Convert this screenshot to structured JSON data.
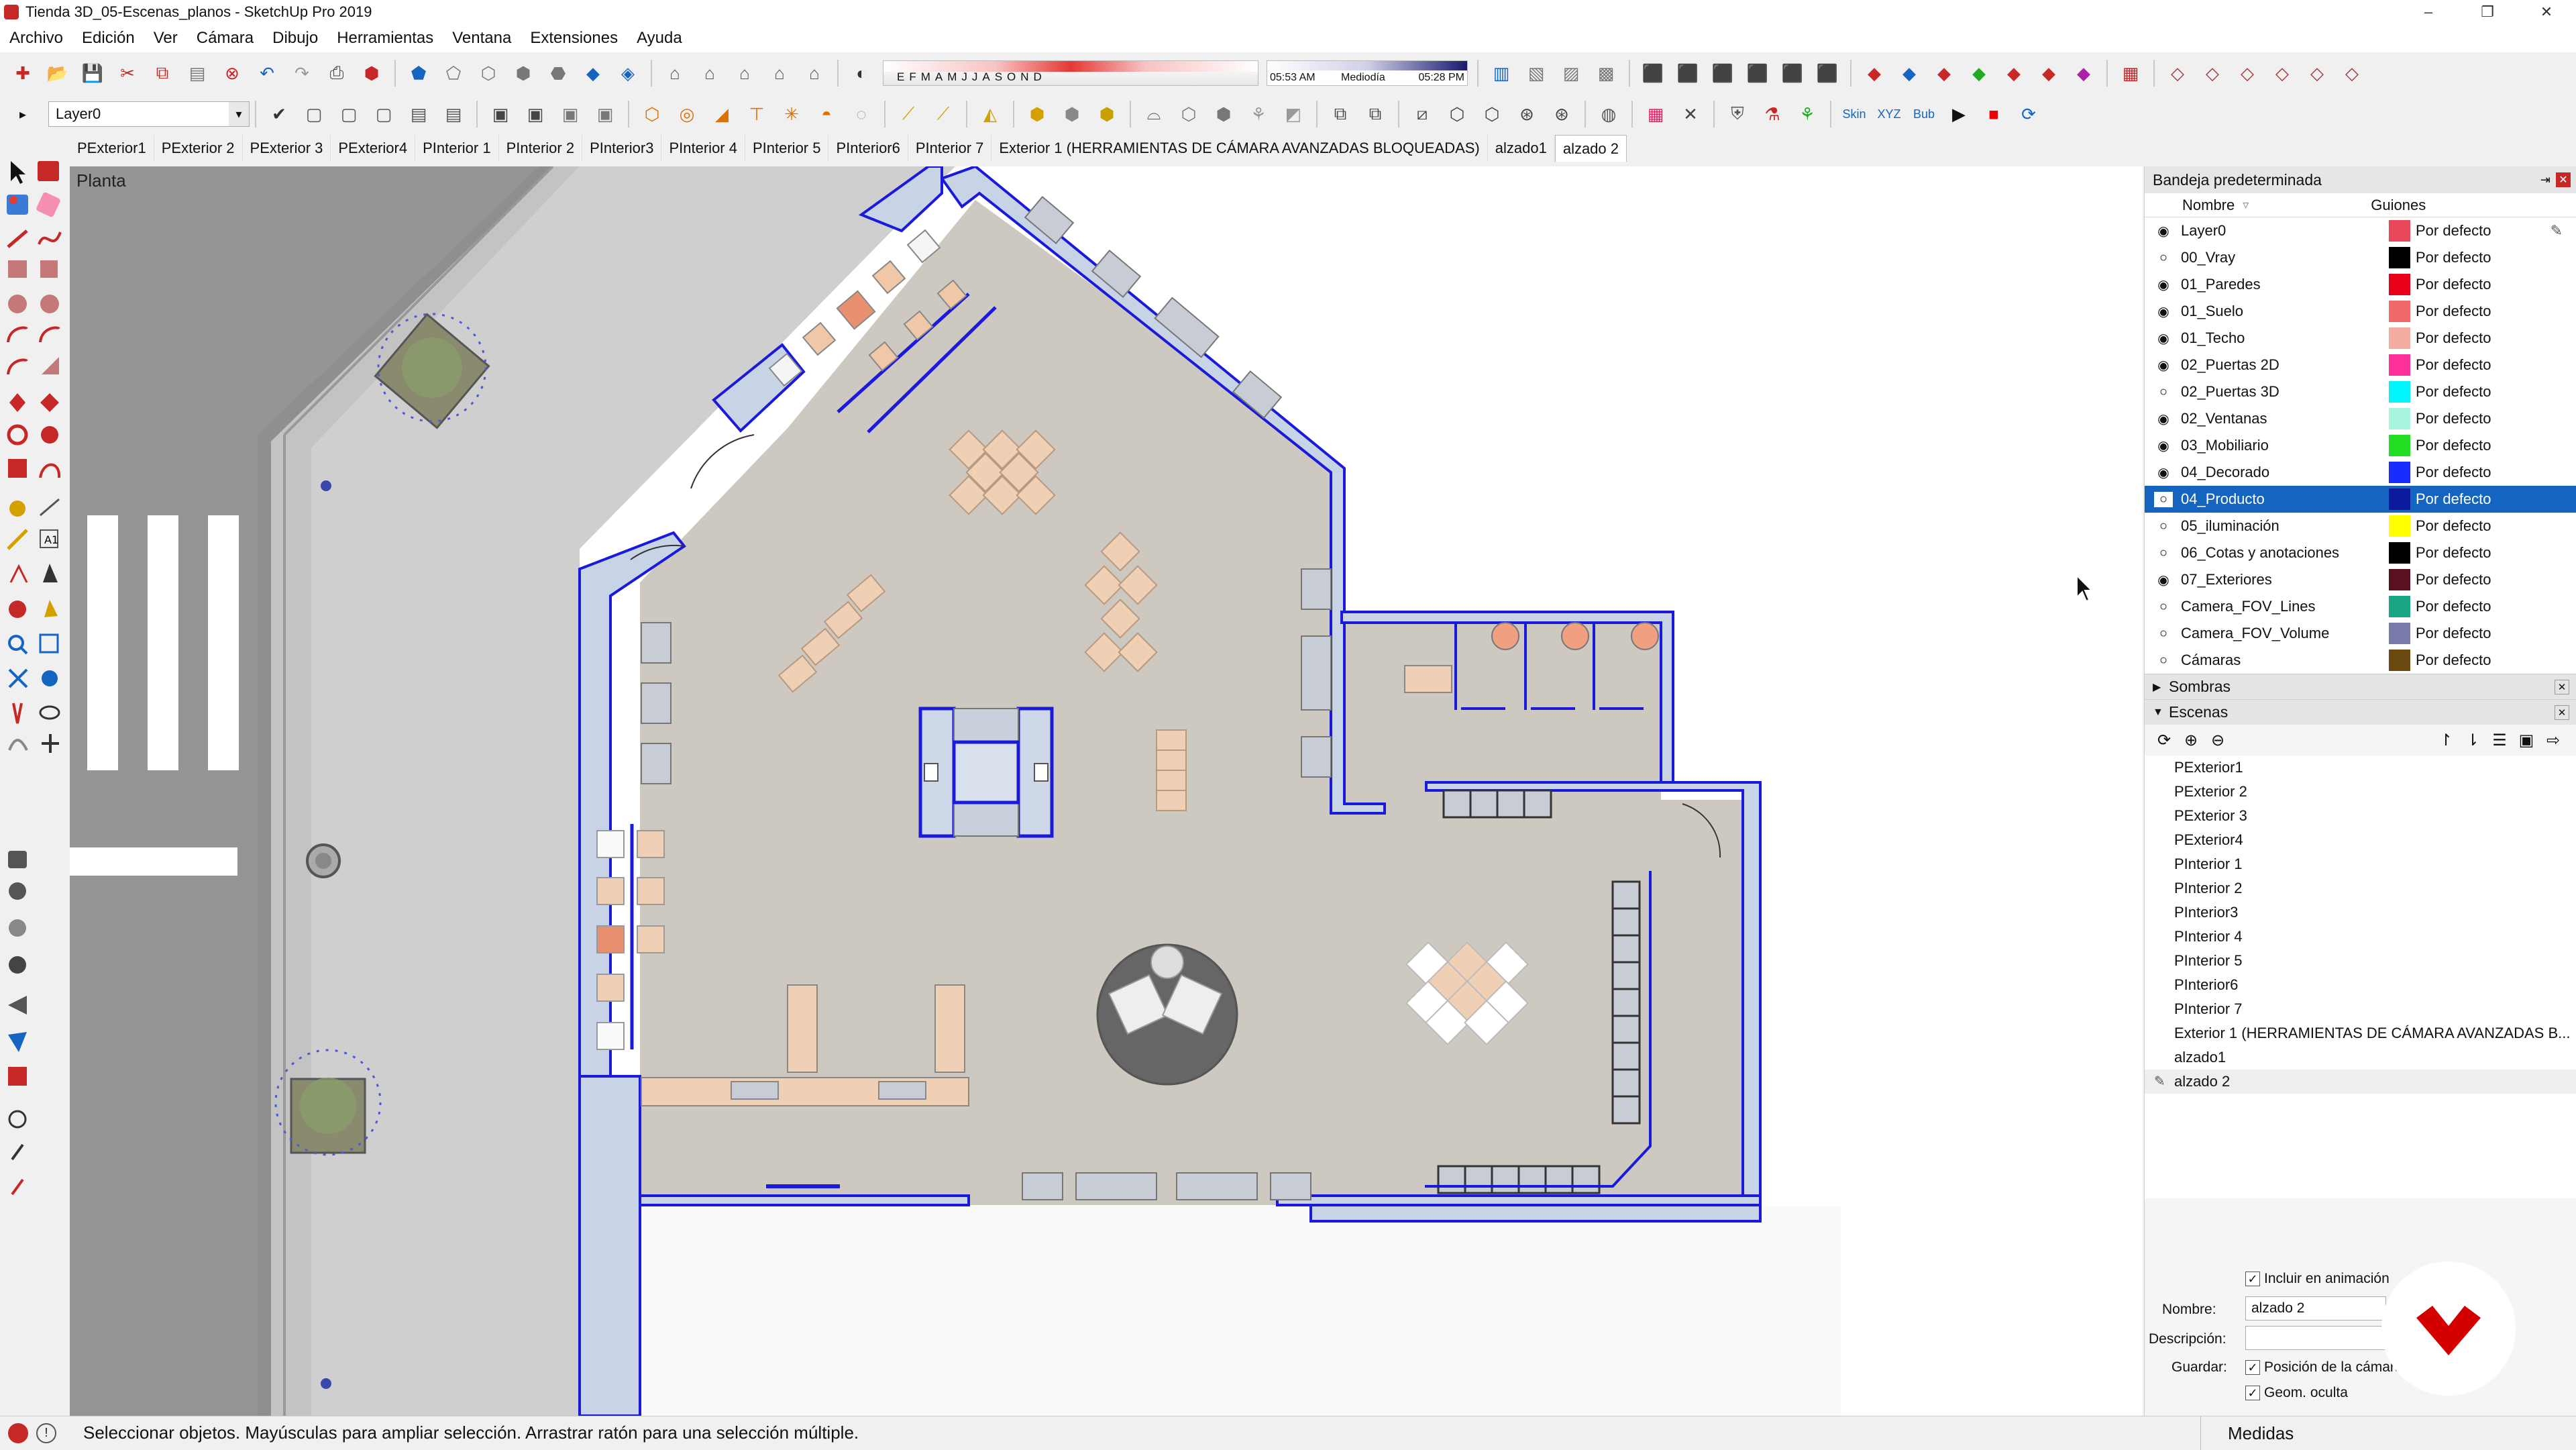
{
  "window": {
    "title": "Tienda 3D_05-Escenas_planos - SketchUp Pro 2019",
    "controls": [
      "–",
      "❐",
      "✕"
    ]
  },
  "menu": [
    "Archivo",
    "Edición",
    "Ver",
    "Cámara",
    "Dibujo",
    "Herramientas",
    "Ventana",
    "Extensiones",
    "Ayuda"
  ],
  "shadows": {
    "months": "EFMAMJJASOND",
    "time_start": "05:53 AM",
    "time_mid": "Mediodía",
    "time_end": "05:28 PM"
  },
  "layer_select": {
    "value": "Layer0"
  },
  "scene_tabs": [
    "PExterior1",
    "PExterior 2",
    "PExterior 3",
    "PExterior4",
    "PInterior 1",
    "PInterior 2",
    "PInterior3",
    "PInterior 4",
    "PInterior 5",
    "PInterior6",
    "PInterior 7",
    "Exterior 1 (HERRAMIENTAS DE CÁMARA AVANZADAS BLOQUEADAS)",
    "alzado1",
    "alzado 2"
  ],
  "viewport": {
    "label": "Planta"
  },
  "tray": {
    "title": "Bandeja predeterminada",
    "layers": {
      "col_name": "Nombre",
      "col_dashes": "Guiones",
      "rows": [
        {
          "name": "Layer0",
          "visible": true,
          "color": "#e8475a",
          "style": "Por defecto"
        },
        {
          "name": "00_Vray",
          "visible": false,
          "color": "#000000",
          "style": "Por defecto"
        },
        {
          "name": "01_Paredes",
          "visible": true,
          "color": "#e8001a",
          "style": "Por defecto"
        },
        {
          "name": "01_Suelo",
          "visible": true,
          "color": "#f06a6a",
          "style": "Por defecto"
        },
        {
          "name": "01_Techo",
          "visible": true,
          "color": "#f5aca0",
          "style": "Por defecto"
        },
        {
          "name": "02_Puertas 2D",
          "visible": true,
          "color": "#ff2f9c",
          "style": "Por defecto"
        },
        {
          "name": "02_Puertas 3D",
          "visible": false,
          "color": "#00f5ff",
          "style": "Por defecto"
        },
        {
          "name": "02_Ventanas",
          "visible": true,
          "color": "#a8f5e0",
          "style": "Por defecto"
        },
        {
          "name": "03_Mobiliario",
          "visible": true,
          "color": "#22dd22",
          "style": "Por defecto"
        },
        {
          "name": "04_Decorado",
          "visible": true,
          "color": "#1a2cff",
          "style": "Por defecto"
        },
        {
          "name": "04_Producto",
          "visible": false,
          "color": "#0a1a9a",
          "style": "Por defecto",
          "selected": true
        },
        {
          "name": "05_iluminación",
          "visible": false,
          "color": "#ffff00",
          "style": "Por defecto"
        },
        {
          "name": "06_Cotas y anotaciones",
          "visible": false,
          "color": "#000000",
          "style": "Por defecto"
        },
        {
          "name": "07_Exteriores",
          "visible": true,
          "color": "#5a1020",
          "style": "Por defecto"
        },
        {
          "name": "Camera_FOV_Lines",
          "visible": false,
          "color": "#1aa585",
          "style": "Por defecto"
        },
        {
          "name": "Camera_FOV_Volume",
          "visible": false,
          "color": "#7a7aaa",
          "style": "Por defecto"
        },
        {
          "name": "Cámaras",
          "visible": false,
          "color": "#6b4a12",
          "style": "Por defecto"
        }
      ]
    },
    "shadows_panel": "Sombras",
    "scenes_panel": "Escenas",
    "scenes": [
      "PExterior1",
      "PExterior 2",
      "PExterior 3",
      "PExterior4",
      "PInterior 1",
      "PInterior 2",
      "PInterior3",
      "PInterior 4",
      "PInterior 5",
      "PInterior6",
      "PInterior 7",
      "Exterior 1 (HERRAMIENTAS DE CÁMARA AVANZADAS B...",
      "alzado1",
      "alzado 2"
    ],
    "scene_props": {
      "include_animation": "Incluir en animación",
      "name_label": "Nombre:",
      "name_value": "alzado 2",
      "description_label": "Descripción:",
      "save_label": "Guardar:",
      "save_camera": "Posición de la cámara",
      "save_hidden": "Geom. oculta"
    }
  },
  "status": {
    "message": "Seleccionar objetos. Mayúsculas para ampliar selección. Arrastrar ratón para una selección múltiple.",
    "measures_label": "Medidas"
  },
  "colors": {
    "wall_blue": "#1a1adb",
    "floor": "#cfcbc4",
    "street": "#8f8f8f",
    "sidewalk": "#c3c3c3",
    "selection": "#1565c0",
    "brand": "#d40000"
  }
}
